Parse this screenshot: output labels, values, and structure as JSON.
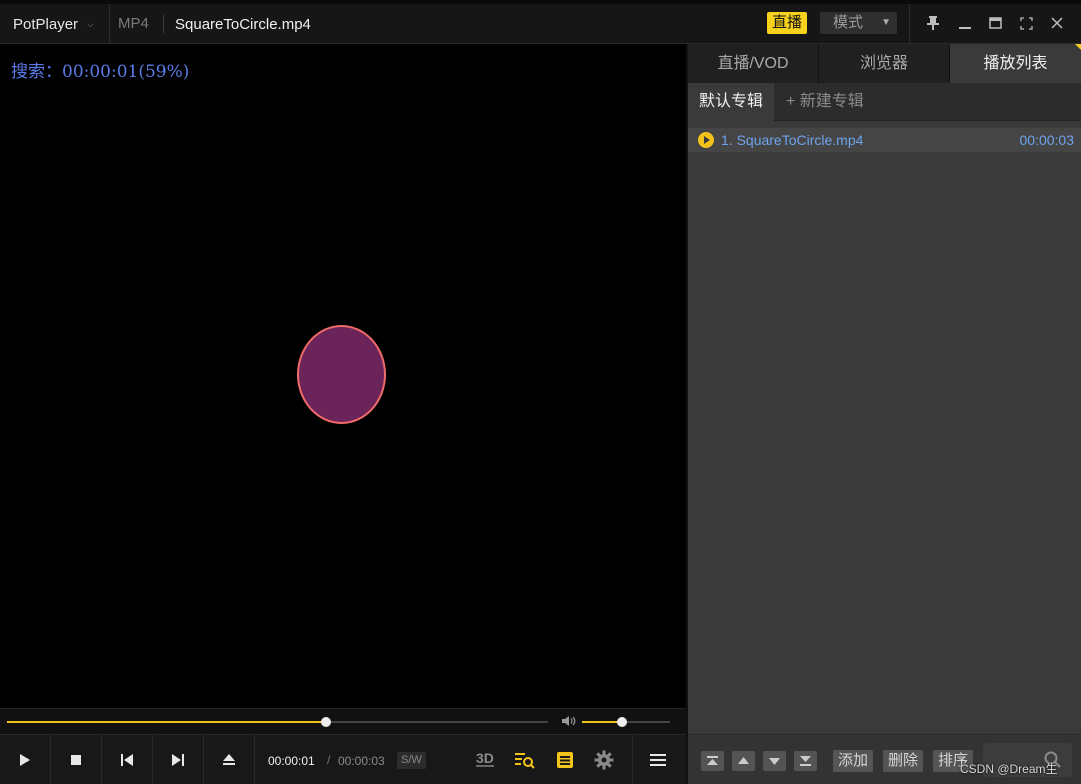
{
  "titlebar": {
    "app_name": "PotPlayer",
    "format": "MP4",
    "filename": "SquareToCircle.mp4",
    "live_badge": "直播",
    "mode_label": "模式"
  },
  "video": {
    "osd_text": "搜索：00:00:01(59%)",
    "seek_progress": 0.59,
    "volume_level": 0.45
  },
  "controls": {
    "current_time": "00:00:01",
    "separator": "/",
    "total_time": "00:00:03",
    "sw_label": "S/W",
    "btn_3d": "3D"
  },
  "panel": {
    "tabs": [
      {
        "label": "直播/VOD",
        "active": false
      },
      {
        "label": "浏览器",
        "active": false
      },
      {
        "label": "播放列表",
        "active": true
      }
    ],
    "album_tab": "默认专辑",
    "new_album": "+ 新建专辑",
    "playlist": [
      {
        "title": "1. SquareToCircle.mp4",
        "duration": "00:00:03"
      }
    ],
    "buttons": {
      "add": "添加",
      "delete": "删除",
      "sort": "排序"
    }
  },
  "watermark": "CSDN @Dream生",
  "colors": {
    "accent": "#f3c51a",
    "osd": "#5b7be8",
    "playlist_text": "#6ea3ee",
    "shape_fill": "#6b2459",
    "shape_stroke": "#f06a6a"
  }
}
